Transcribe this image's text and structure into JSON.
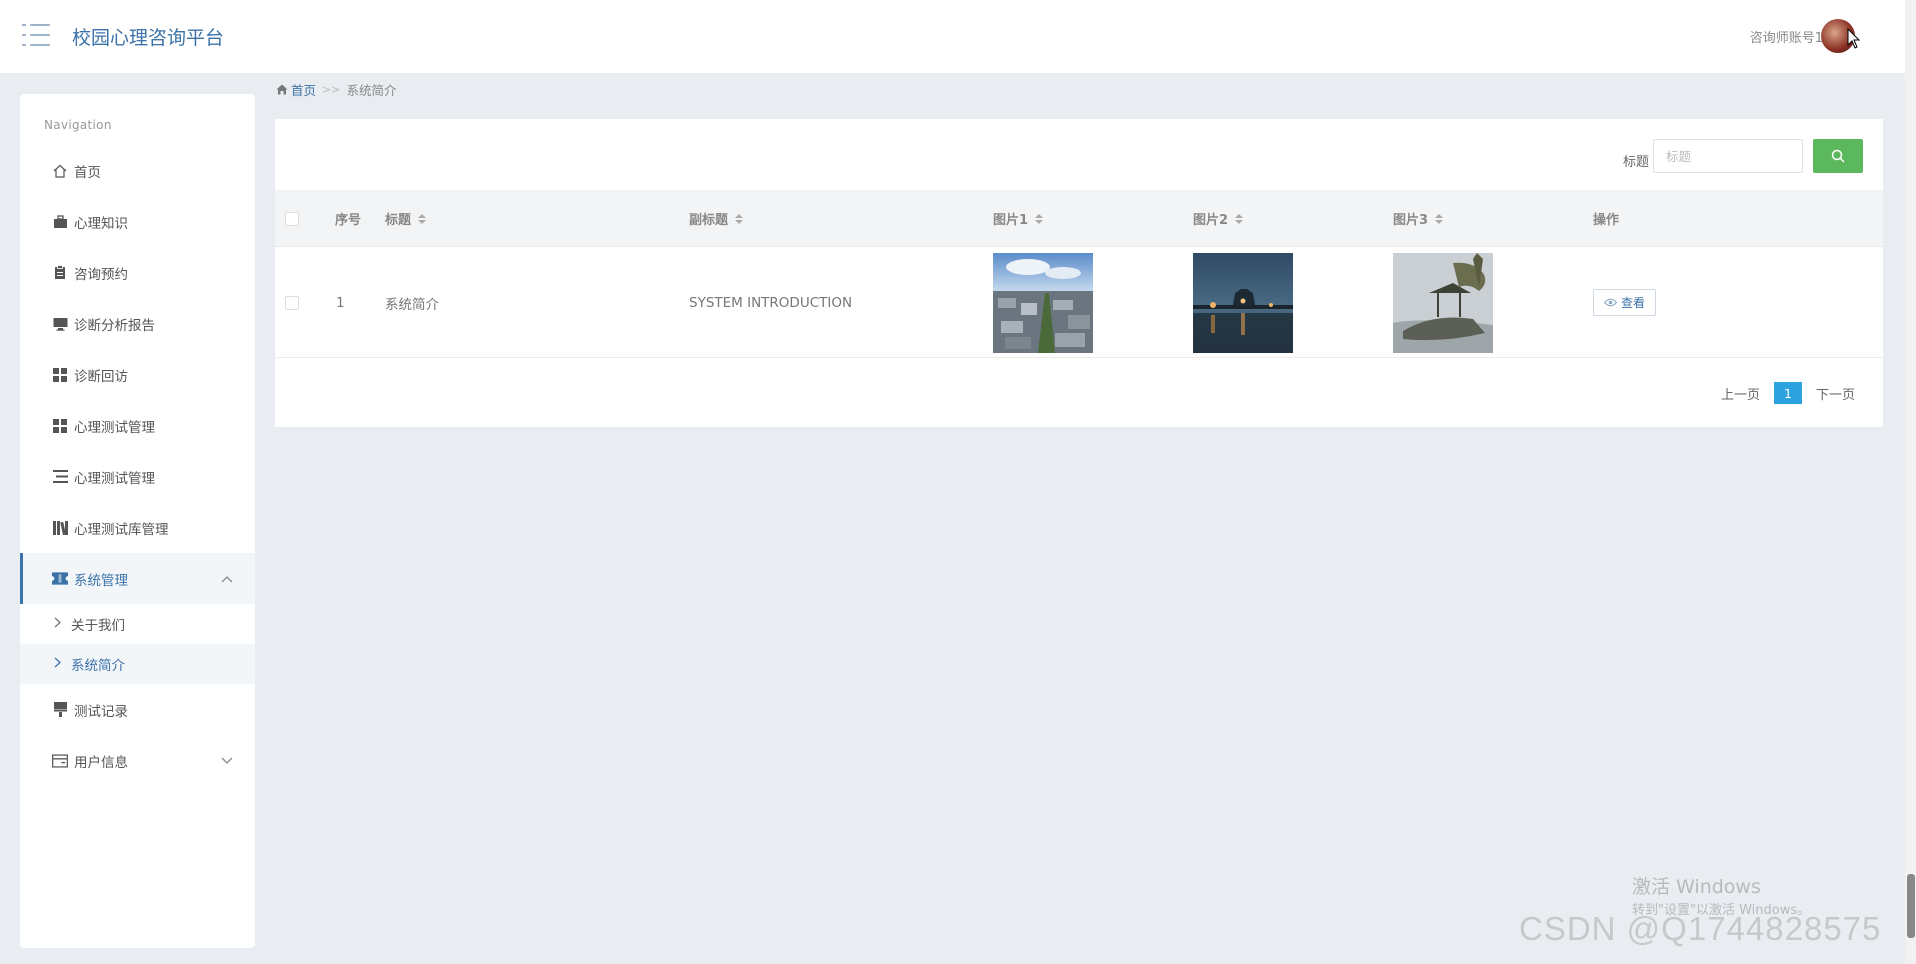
{
  "header": {
    "title": "校园心理咨询平台",
    "account": "咨询师账号1"
  },
  "sidebar": {
    "heading": "Navigation",
    "items": [
      {
        "label": "首页",
        "icon": "home-icon"
      },
      {
        "label": "心理知识",
        "icon": "briefcase-icon"
      },
      {
        "label": "咨询预约",
        "icon": "clipboard-icon"
      },
      {
        "label": "诊断分析报告",
        "icon": "monitor-icon"
      },
      {
        "label": "诊断回访",
        "icon": "grid-icon"
      },
      {
        "label": "心理测试管理",
        "icon": "grid-icon"
      },
      {
        "label": "心理测试管理",
        "icon": "list-icon"
      },
      {
        "label": "心理测试库管理",
        "icon": "books-icon"
      },
      {
        "label": "系统管理",
        "icon": "ticket-icon"
      },
      {
        "label": "测试记录",
        "icon": "stamp-icon"
      },
      {
        "label": "用户信息",
        "icon": "card-icon"
      }
    ],
    "system_submenu": [
      {
        "label": "关于我们"
      },
      {
        "label": "系统简介"
      }
    ]
  },
  "breadcrumb": {
    "home": "首页",
    "separator": ">>",
    "current": "系统简介"
  },
  "search": {
    "label": "标题",
    "placeholder": "标题"
  },
  "table": {
    "columns": [
      "序号",
      "标题",
      "副标题",
      "图片1",
      "图片2",
      "图片3",
      "操作"
    ],
    "rows": [
      {
        "index": "1",
        "title": "系统简介",
        "subtitle": "SYSTEM INTRODUCTION",
        "action": "查看"
      }
    ]
  },
  "pagination": {
    "prev": "上一页",
    "current": "1",
    "next": "下一页"
  },
  "watermarks": {
    "windows_title": "激活 Windows",
    "windows_sub": "转到\"设置\"以激活 Windows。",
    "csdn": "CSDN @Q1744828575"
  },
  "colors": {
    "brand": "#3b73a8",
    "search_button": "#5cb85c",
    "page_active": "#2ca2de"
  }
}
